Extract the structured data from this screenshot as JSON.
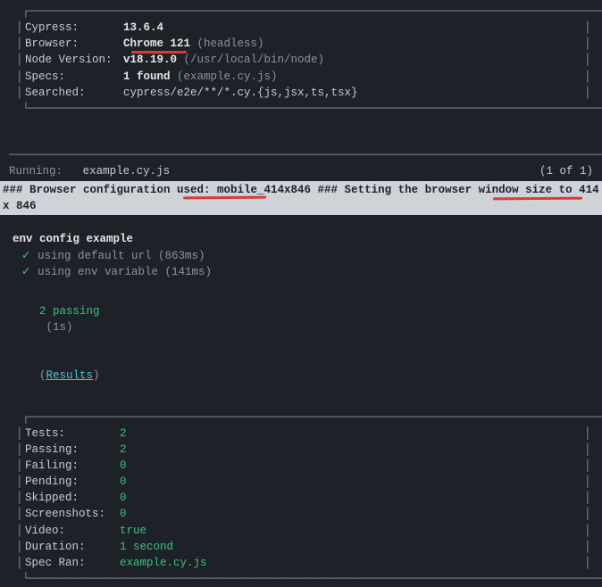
{
  "header": {
    "rows": [
      {
        "label": "Cypress:",
        "value": "13.6.4",
        "value_class": "white",
        "extra": ""
      },
      {
        "label": "Browser:",
        "value": "Chrome 121",
        "value_class": "white",
        "extra": "(headless)"
      },
      {
        "label": "Node Version:",
        "value": "v18.19.0",
        "value_class": "white",
        "extra": "(/usr/local/bin/node)"
      },
      {
        "label": "Specs:",
        "value": "1 found",
        "value_class": "white",
        "extra": "(example.cy.js)"
      },
      {
        "label": "Searched:",
        "value": "cypress/e2e/**/*.cy.{js,jsx,ts,tsx}",
        "value_class": "",
        "extra": ""
      }
    ]
  },
  "running": {
    "label": "Running:",
    "spec": "example.cy.js",
    "counter": "(1 of 1)"
  },
  "highlight": "### Browser configuration used: mobile_414x846 ### Setting the browser window size to 414 x 846 ",
  "tests": {
    "title": "env config example",
    "items": [
      {
        "mark": "✓",
        "text": "using default url",
        "time": "(863ms)"
      },
      {
        "mark": "✓",
        "text": "using env variable",
        "time": "(141ms)"
      }
    ],
    "passing": {
      "count": "2 passing",
      "time": "(1s)"
    },
    "results_label": "Results"
  },
  "results": {
    "rows": [
      {
        "label": "Tests:",
        "value": "2",
        "class": "green"
      },
      {
        "label": "Passing:",
        "value": "2",
        "class": "green"
      },
      {
        "label": "Failing:",
        "value": "0",
        "class": "green"
      },
      {
        "label": "Pending:",
        "value": "0",
        "class": "green"
      },
      {
        "label": "Skipped:",
        "value": "0",
        "class": "green"
      },
      {
        "label": "Screenshots:",
        "value": "0",
        "class": "green"
      },
      {
        "label": "Video:",
        "value": "true",
        "class": "green"
      },
      {
        "label": "Duration:",
        "value": "1 second",
        "class": "green"
      },
      {
        "label": "Spec Ran:",
        "value": "example.cy.js",
        "class": "green"
      }
    ]
  },
  "chart_data": {
    "type": "table",
    "title": "Cypress run summary",
    "rows": [
      {
        "metric": "Tests",
        "value": 2
      },
      {
        "metric": "Passing",
        "value": 2
      },
      {
        "metric": "Failing",
        "value": 0
      },
      {
        "metric": "Pending",
        "value": 0
      },
      {
        "metric": "Skipped",
        "value": 0
      },
      {
        "metric": "Screenshots",
        "value": 0
      },
      {
        "metric": "Video",
        "value": "true"
      },
      {
        "metric": "Duration",
        "value": "1 second"
      },
      {
        "metric": "Spec Ran",
        "value": "example.cy.js"
      }
    ]
  }
}
